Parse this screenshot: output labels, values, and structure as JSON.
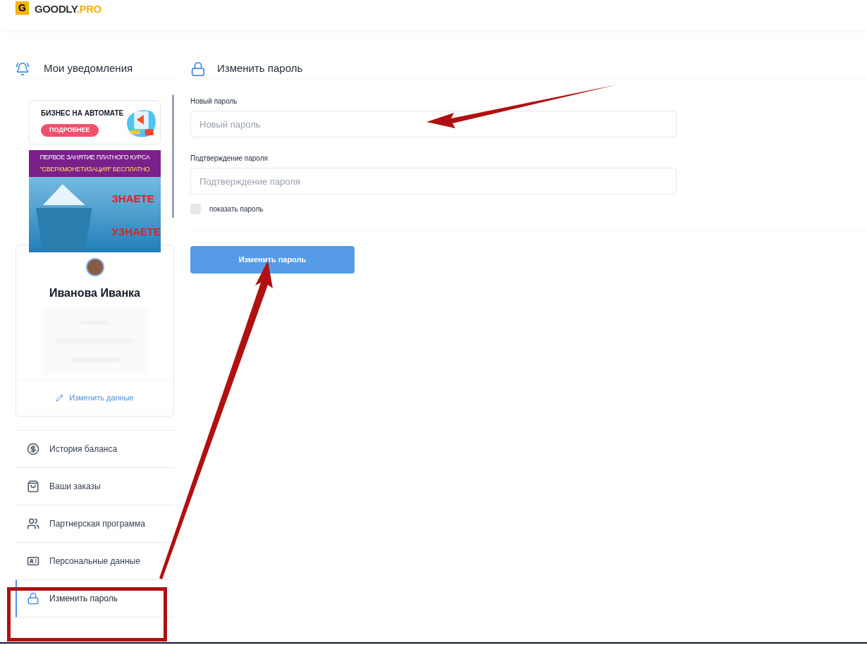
{
  "logo": {
    "mark": "G",
    "name": "GOODLY",
    "suffix": ".PRO"
  },
  "notifications": {
    "title": "Мои уведомления"
  },
  "ads": [
    {
      "kind": "promo",
      "title": "БИЗНЕС НА АВТОМАТЕ",
      "button": "ПОДРОБНЕЕ"
    },
    {
      "kind": "banner",
      "lines": [
        "ПЕРВОЕ ЗАНЯТИЕ ПЛАТНОГО КУРСА",
        "\"СВЕРХМОНЕТИЗАЦИЯ\" БЕСПЛАТНО"
      ],
      "labels": [
        "ЗНАЕТЕ",
        "УЗНАЕТЕ"
      ]
    }
  ],
  "profile": {
    "name": "Иванова Иванка",
    "edit_link": "Изменить данные"
  },
  "menu": [
    {
      "label": "История баланса",
      "selected": false
    },
    {
      "label": "Ваши заказы",
      "selected": false
    },
    {
      "label": "Партнерская программа",
      "selected": false
    },
    {
      "label": "Персональные данные",
      "selected": false
    },
    {
      "label": "Изменить пароль",
      "selected": true
    }
  ],
  "form": {
    "title": "Изменить пароль",
    "fields": [
      {
        "label": "Новый пароль",
        "placeholder": "Новый пароль"
      },
      {
        "label": "Подтверждение пароля",
        "placeholder": "Подтверждение пароля"
      }
    ],
    "show_password": {
      "label": "показать пароль",
      "checked": false
    },
    "submit": "Изменить пароль"
  }
}
